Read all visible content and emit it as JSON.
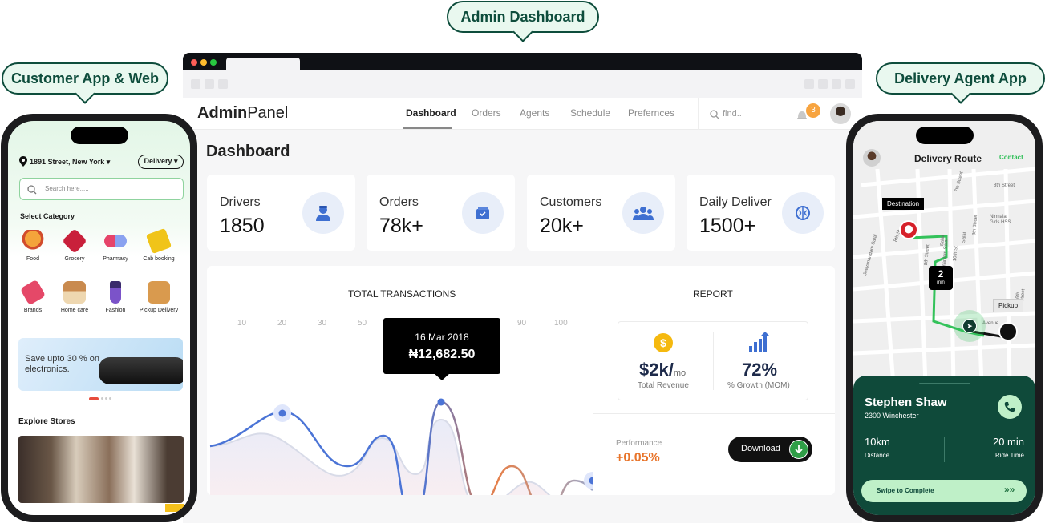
{
  "callouts": {
    "customer": "Customer App & Web",
    "admin": "Admin Dashboard",
    "agent": "Delivery Agent App"
  },
  "admin": {
    "logo_bold": "Admin",
    "logo_rest": "Panel",
    "nav": [
      "Dashboard",
      "Orders",
      "Agents",
      "Schedule",
      "Prefernces"
    ],
    "search_placeholder": "find..",
    "notification_count": "3",
    "page_title": "Dashboard",
    "stats": [
      {
        "label": "Drivers",
        "value": "1850",
        "icon": "driver-icon"
      },
      {
        "label": "Orders",
        "value": "78k+",
        "icon": "box-icon"
      },
      {
        "label": "Customers",
        "value": "20k+",
        "icon": "users-icon"
      },
      {
        "label": "Daily Deliver",
        "value": "1500+",
        "icon": "brain-icon"
      }
    ],
    "transactions": {
      "title": "TOTAL TRANSACTIONS",
      "x_ticks": [
        "10",
        "20",
        "30",
        "50",
        "60",
        "70",
        "80",
        "90",
        "100"
      ],
      "tooltip_date": "16 Mar 2018",
      "tooltip_value": "₦12,682.50"
    },
    "report": {
      "title": "REPORT",
      "revenue_value": "$2k/",
      "revenue_unit": "mo",
      "revenue_label": "Total Revenue",
      "growth_value": "72%",
      "growth_label": "% Growth (MOM)",
      "performance_label": "Performance",
      "performance_value": "+0.05%",
      "download_label": "Download",
      "colors": {
        "performance": "#e8742a",
        "download": "#111111",
        "download_icon": "#2f9e47"
      }
    }
  },
  "customer": {
    "address": "1891 Street, New York",
    "mode": "Delivery",
    "search_placeholder": "Search here.....",
    "category_title": "Select Category",
    "categories": [
      "Food",
      "Grocery",
      "Pharmacy",
      "Cab booking",
      "Brands",
      "Home care",
      "Fashion",
      "Pickup Delivery"
    ],
    "banner_text": "Save upto 30 % on electronics.",
    "explore_title": "Explore Stores"
  },
  "agent": {
    "title": "Delivery Route",
    "contact": "Contact",
    "destination": "Destination",
    "pickup": "Pickup",
    "eta_value": "2",
    "eta_unit": "min",
    "streets": [
      "8th Street",
      "7th Street",
      "8th St",
      "Jeevanandam Salai",
      "Balasubramaniam Salai",
      "8th Street",
      "10th St",
      "Nirmala Girls HSS",
      "8th Street",
      "Salai",
      "Salai",
      "Avenue",
      "16th Street"
    ],
    "name": "Stephen Shaw",
    "address": "2300 Winchester",
    "distance_value": "10km",
    "distance_label": "Distance",
    "time_value": "20 min",
    "time_label": "Ride Time",
    "swipe_label": "Swipe to Complete",
    "colors": {
      "panel": "#0f4a3a",
      "route": "#33c25a",
      "accent": "#9be6a8"
    }
  }
}
